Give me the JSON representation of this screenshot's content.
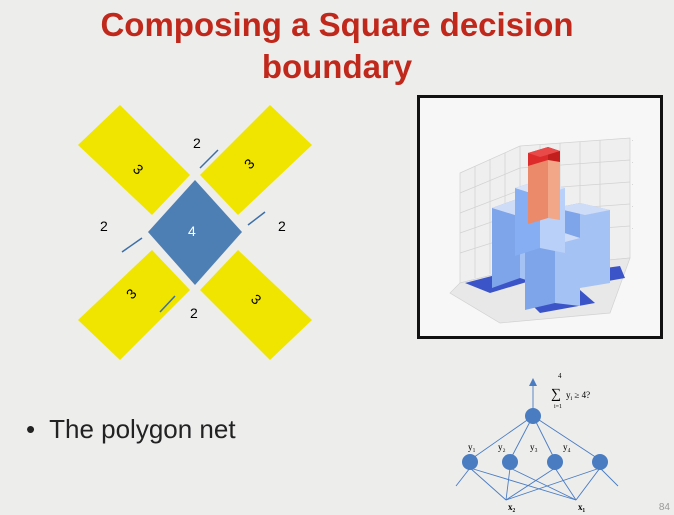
{
  "slide": {
    "title_line1": "Composing a Square decision",
    "title_line2": "boundary",
    "bullet": "The polygon net",
    "page_number": "84"
  },
  "cross_diagram": {
    "arm_labels": [
      "3",
      "3",
      "3",
      "3"
    ],
    "center_label": "4",
    "region_labels": [
      "2",
      "2",
      "2",
      "2"
    ],
    "colors": {
      "arm": "#f0e500",
      "center": "#4e7fb4"
    }
  },
  "network": {
    "output_formula": "∑ y_i ≥ 4?",
    "sum_upper": "4",
    "sum_lower": "i=1",
    "hidden_labels": [
      "y₁",
      "y₂",
      "y₃",
      "y₄"
    ],
    "input_labels": [
      "x₂",
      "x₁"
    ],
    "node_color": "#4a7cc2"
  },
  "chart_data": {
    "type": "bar3d",
    "description_values": {
      "center": 4,
      "arms": 3,
      "corners": 2
    },
    "colors": {
      "center": "#dd2b2b",
      "mid": "#eb8a6a",
      "arms": "#86aef2",
      "floor": "#3b55c8"
    }
  }
}
